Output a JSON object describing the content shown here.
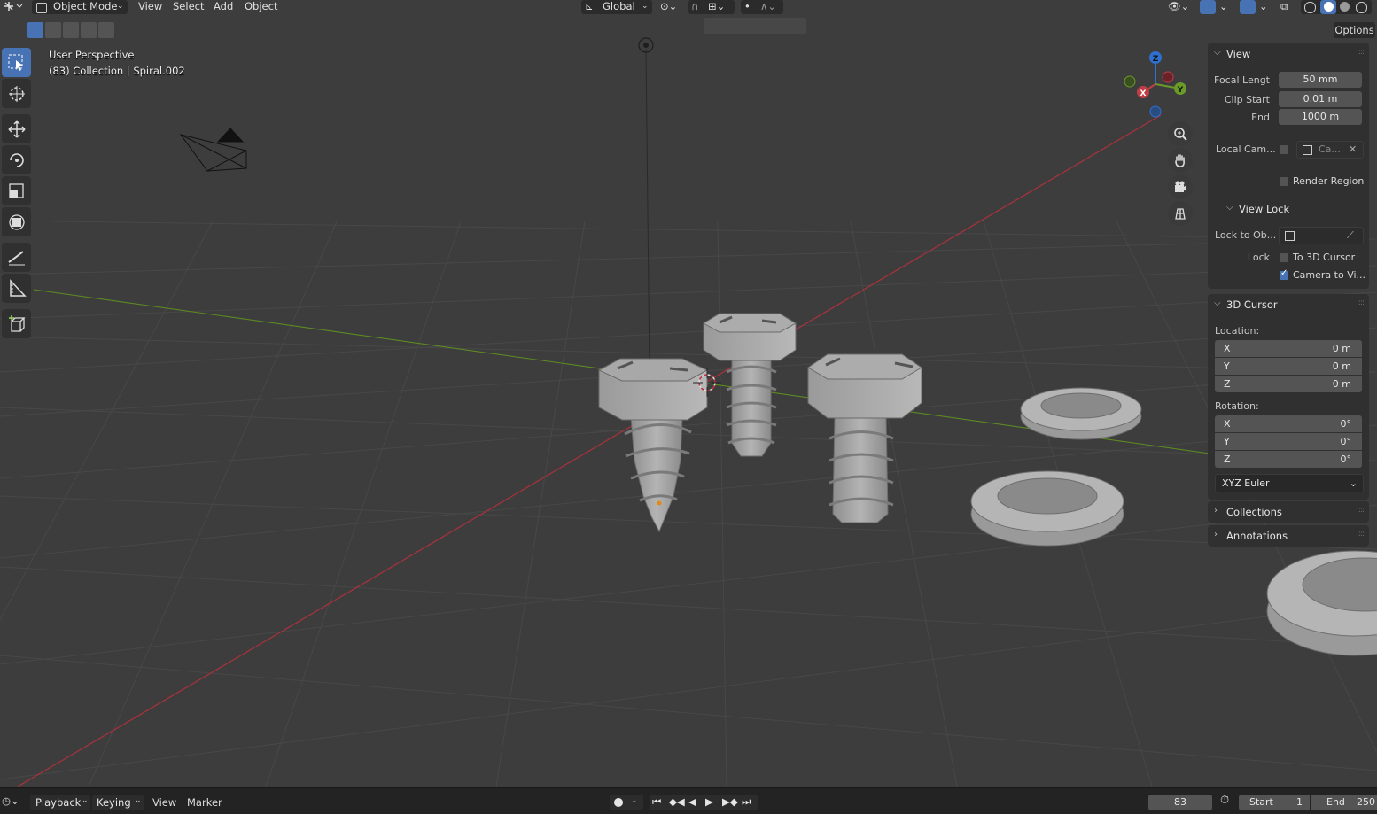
{
  "header": {
    "mode_label": "Object Mode",
    "menus": [
      "View",
      "Select",
      "Add",
      "Object"
    ],
    "transform_orientation": "Global"
  },
  "viewport": {
    "perspective_label": "User Perspective",
    "collection_label": "(83) Collection | Spiral.002",
    "gizmo_axes": {
      "x": "X",
      "y": "Y",
      "z": "Z"
    }
  },
  "sidebar": {
    "options_label": "Options",
    "view": {
      "title": "View",
      "focal_length_label": "Focal Lengt",
      "focal_length_value": "50 mm",
      "clip_start_label": "Clip Start",
      "clip_start_value": "0.01 m",
      "end_label": "End",
      "end_value": "1000 m",
      "local_camera_label": "Local Cam...",
      "local_camera_value": "Ca...",
      "render_region_label": "Render Region"
    },
    "view_lock": {
      "title": "View Lock",
      "lock_to_object_label": "Lock to Ob...",
      "lock_label": "Lock",
      "to_3d_cursor_label": "To 3D Cursor",
      "to_3d_cursor_checked": false,
      "camera_to_view_label": "Camera to Vi...",
      "camera_to_view_checked": true
    },
    "cursor": {
      "title": "3D Cursor",
      "location_label": "Location:",
      "location": [
        {
          "axis": "X",
          "value": "0 m"
        },
        {
          "axis": "Y",
          "value": "0 m"
        },
        {
          "axis": "Z",
          "value": "0 m"
        }
      ],
      "rotation_label": "Rotation:",
      "rotation": [
        {
          "axis": "X",
          "value": "0°"
        },
        {
          "axis": "Y",
          "value": "0°"
        },
        {
          "axis": "Z",
          "value": "0°"
        }
      ],
      "rotation_mode": "XYZ Euler"
    },
    "collections_title": "Collections",
    "annotations_title": "Annotations"
  },
  "timeline": {
    "menus": [
      "Playback",
      "Keying",
      "View",
      "Marker"
    ],
    "current_frame": "83",
    "start_label": "Start",
    "start_value": "1",
    "end_label": "End",
    "end_value": "250"
  },
  "colors": {
    "accent": "#4772b3",
    "x_axis": "#c03c46",
    "y_axis": "#6a9a28",
    "z_axis": "#2f6fd0",
    "background": "#3d3d3d"
  }
}
